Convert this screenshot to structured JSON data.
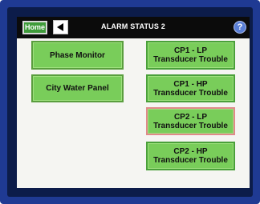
{
  "header": {
    "home_label": "Home",
    "title": "ALARM STATUS 2",
    "help_label": "?"
  },
  "left_buttons": [
    {
      "label": "Phase Monitor"
    },
    {
      "label": "City Water Panel"
    }
  ],
  "right_buttons": [
    {
      "line1": "CP1 - LP",
      "line2": "Transducer Trouble"
    },
    {
      "line1": "CP1 - HP",
      "line2": "Transducer Trouble"
    },
    {
      "line1": "CP2 - LP",
      "line2": "Transducer Trouble"
    },
    {
      "line1": "CP2 - HP",
      "line2": "Transducer Trouble"
    }
  ],
  "colors": {
    "frame": "#1f3a93",
    "titlebar": "#0b0b0b",
    "button_green": "#79cd5a",
    "home_green": "#3f9b3a",
    "help_blue": "#5a7fd6"
  },
  "icons": {
    "back": "back-arrow-icon",
    "help": "help-icon"
  }
}
